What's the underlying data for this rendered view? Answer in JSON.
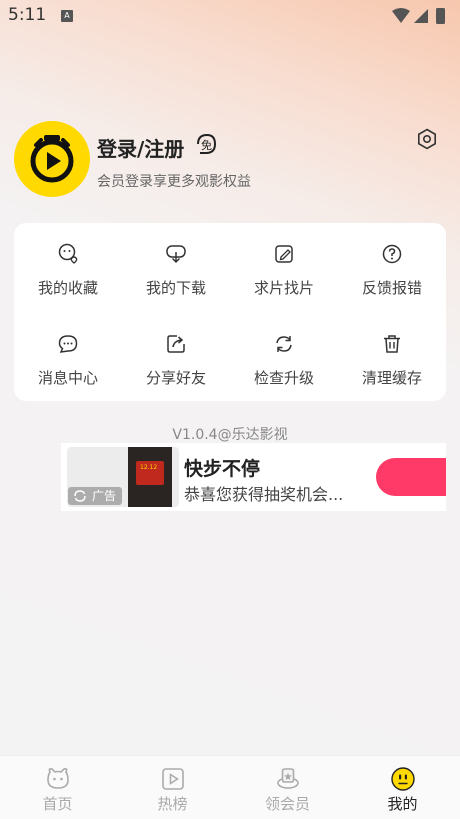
{
  "status_bar": {
    "time": "5:11",
    "notification": "A"
  },
  "profile": {
    "login_label": "登录/注册",
    "badge": "免",
    "subtitle": "会员登录享更多观影权益"
  },
  "grid": [
    {
      "label": "我的收藏",
      "icon": "favorites-icon"
    },
    {
      "label": "我的下载",
      "icon": "download-icon"
    },
    {
      "label": "求片找片",
      "icon": "request-movie-icon"
    },
    {
      "label": "反馈报错",
      "icon": "feedback-icon"
    },
    {
      "label": "消息中心",
      "icon": "message-icon"
    },
    {
      "label": "分享好友",
      "icon": "share-icon"
    },
    {
      "label": "检查升级",
      "icon": "update-icon"
    },
    {
      "label": "清理缓存",
      "icon": "trash-icon"
    }
  ],
  "version": "V1.0.4@乐达影视",
  "ad": {
    "tag": "广告",
    "title": "快步不停",
    "description": "恭喜您获得抽奖机会...",
    "thumb_text": "12.12"
  },
  "nav": [
    {
      "label": "首页",
      "icon": "home-icon",
      "active": false
    },
    {
      "label": "热榜",
      "icon": "hot-list-icon",
      "active": false
    },
    {
      "label": "领会员",
      "icon": "vip-icon",
      "active": false
    },
    {
      "label": "我的",
      "icon": "mine-icon",
      "active": true
    }
  ],
  "colors": {
    "accent": "#ffd900",
    "ad_button": "#ff3a68"
  }
}
